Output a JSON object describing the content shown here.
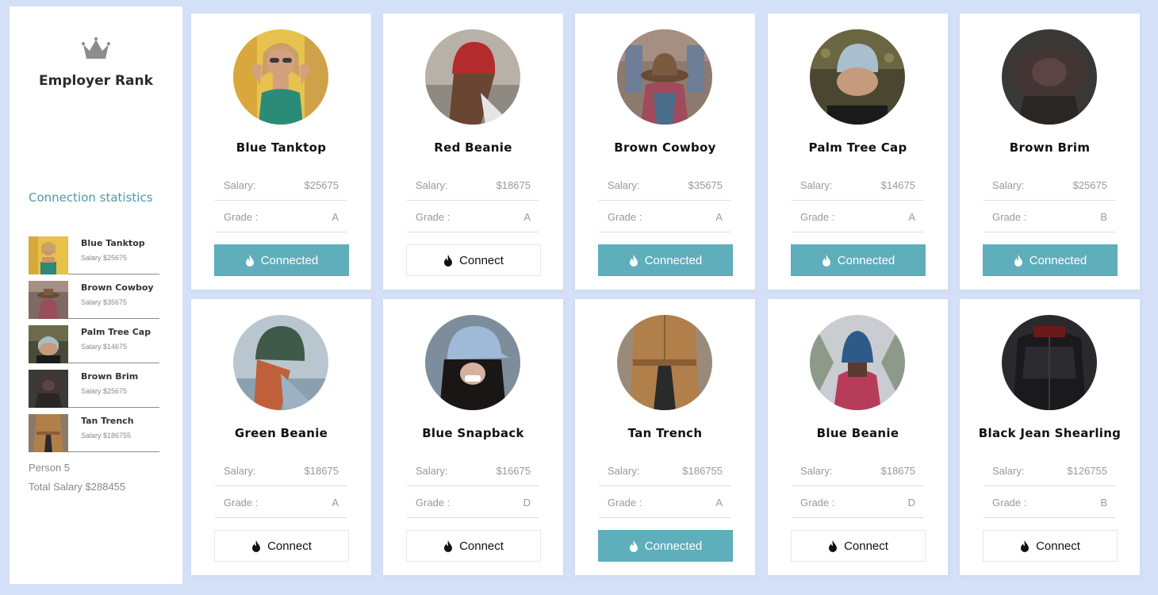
{
  "sidebar": {
    "brand": "Employer Rank",
    "stats_title": "Connection statistics",
    "stats": [
      {
        "name": "Blue Tanktop",
        "salary": "Salary $25675"
      },
      {
        "name": "Brown Cowboy",
        "salary": "Salary $35675"
      },
      {
        "name": "Palm Tree Cap",
        "salary": "Salary $14675"
      },
      {
        "name": "Brown Brim",
        "salary": "Salary $25675"
      },
      {
        "name": "Tan Trench",
        "salary": "Salary $186755"
      }
    ],
    "person_count": "Person 5",
    "total_salary": "Total Salary $288455"
  },
  "labels": {
    "salary": "Salary:",
    "grade": "Grade :"
  },
  "cards": [
    {
      "name": "Blue Tanktop",
      "salary": "$25675",
      "grade": "A",
      "button": "Connected",
      "state": "connected"
    },
    {
      "name": "Red Beanie",
      "salary": "$18675",
      "grade": "A",
      "button": "Connect",
      "state": "connect"
    },
    {
      "name": "Brown Cowboy",
      "salary": "$35675",
      "grade": "A",
      "button": "Connected",
      "state": "connected"
    },
    {
      "name": "Palm Tree Cap",
      "salary": "$14675",
      "grade": "A",
      "button": "Connected",
      "state": "connected"
    },
    {
      "name": "Brown Brim",
      "salary": "$25675",
      "grade": "B",
      "button": "Connected",
      "state": "connected"
    },
    {
      "name": "Green Beanie",
      "salary": "$18675",
      "grade": "A",
      "button": "Connect",
      "state": "connect"
    },
    {
      "name": "Blue Snapback",
      "salary": "$16675",
      "grade": "D",
      "button": "Connect",
      "state": "connect"
    },
    {
      "name": "Tan Trench",
      "salary": "$186755",
      "grade": "A",
      "button": "Connected",
      "state": "connected"
    },
    {
      "name": "Blue Beanie",
      "salary": "$18675",
      "grade": "D",
      "button": "Connect",
      "state": "connect"
    },
    {
      "name": "Black Jean Shearling",
      "salary": "$126755",
      "grade": "B",
      "button": "Connect",
      "state": "connect"
    }
  ],
  "colors": {
    "accent": "#5eaebb",
    "background": "#d3e0f7",
    "stats_title": "#4f9aa6"
  },
  "icons": {
    "brand": "crown-icon",
    "button": "flame-icon"
  }
}
